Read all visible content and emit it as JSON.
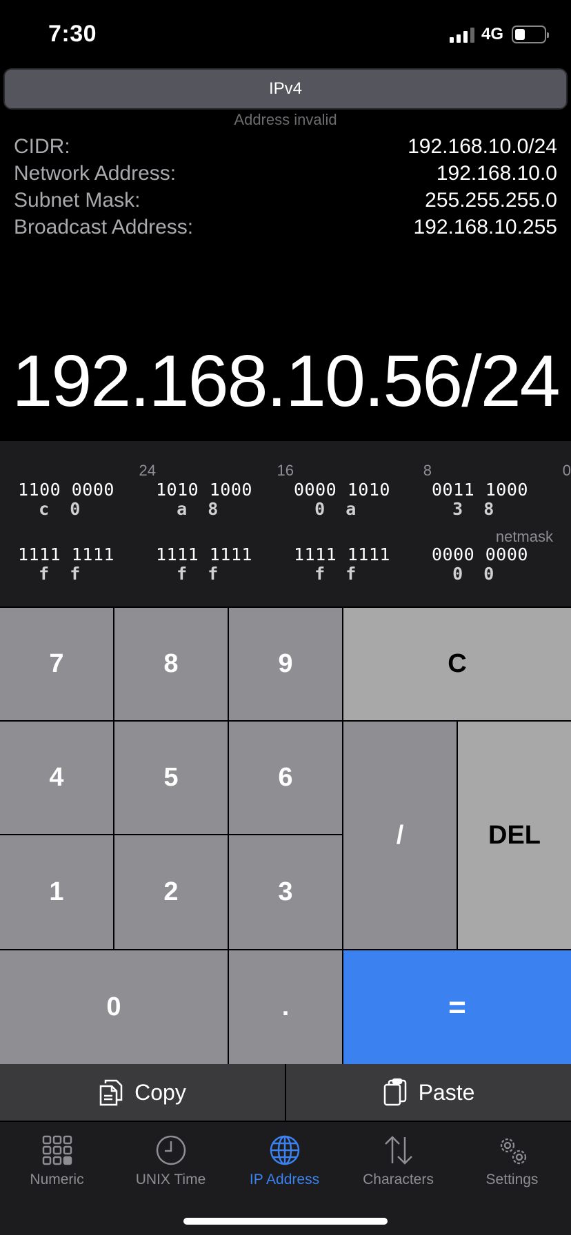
{
  "status_bar": {
    "time": "7:30",
    "network": "4G",
    "battery_level": 0.25
  },
  "segment": {
    "label": "IPv4"
  },
  "address_status": "Address invalid",
  "info": [
    {
      "label": "CIDR:",
      "value": "192.168.10.0/24"
    },
    {
      "label": "Network Address:",
      "value": "192.168.10.0"
    },
    {
      "label": "Subnet Mask:",
      "value": "255.255.255.0"
    },
    {
      "label": "Broadcast Address:",
      "value": "192.168.10.255"
    }
  ],
  "display": "192.168.10.56/24",
  "binary": {
    "bit_labels": [
      "24",
      "16",
      "8",
      "0"
    ],
    "address": [
      {
        "bits": "1100 0000",
        "hex": "  c  0"
      },
      {
        "bits": "1010 1000",
        "hex": "  a  8"
      },
      {
        "bits": "0000 1010",
        "hex": "  0  a"
      },
      {
        "bits": "0011 1000",
        "hex": "  3  8"
      }
    ],
    "netmask_label": "netmask",
    "netmask": [
      {
        "bits": "1111 1111",
        "hex": "  f  f"
      },
      {
        "bits": "1111 1111",
        "hex": "  f  f"
      },
      {
        "bits": "1111 1111",
        "hex": "  f  f"
      },
      {
        "bits": "0000 0000",
        "hex": "  0  0"
      }
    ]
  },
  "keypad": {
    "k7": "7",
    "k8": "8",
    "k9": "9",
    "clear": "C",
    "k4": "4",
    "k5": "5",
    "k6": "6",
    "slash": "/",
    "del": "DEL",
    "k1": "1",
    "k2": "2",
    "k3": "3",
    "k0": "0",
    "dot": ".",
    "equals": "="
  },
  "actions": {
    "copy": "Copy",
    "paste": "Paste"
  },
  "tabs": [
    {
      "label": "Numeric",
      "icon": "grid-icon"
    },
    {
      "label": "UNIX Time",
      "icon": "clock-icon"
    },
    {
      "label": "IP Address",
      "icon": "globe-icon",
      "active": true
    },
    {
      "label": "Characters",
      "icon": "arrows-updown-icon"
    },
    {
      "label": "Settings",
      "icon": "gears-icon"
    }
  ],
  "colors": {
    "accent": "#3b82f0",
    "key": "#8e8e93",
    "key_light": "#a8a8a8",
    "panel": "#1c1c1e"
  }
}
